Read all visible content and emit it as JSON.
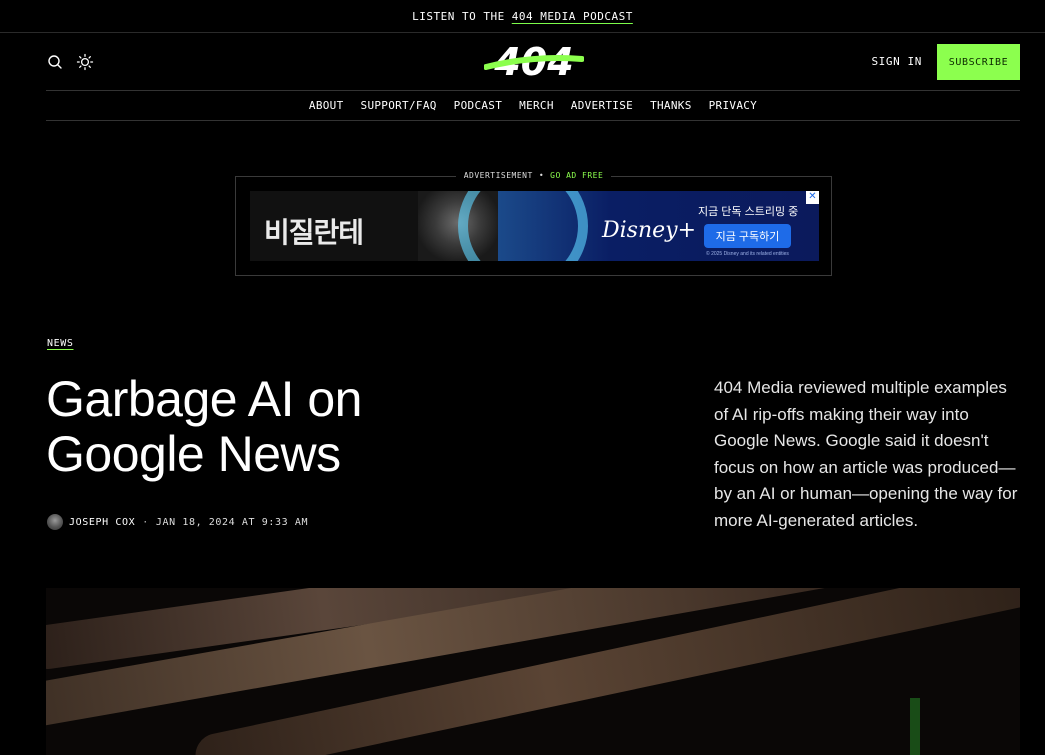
{
  "topbar": {
    "prefix": "LISTEN TO THE",
    "link": "404 MEDIA PODCAST"
  },
  "header": {
    "logo_text": "404",
    "search_icon": "search-icon",
    "theme_icon": "sun-icon",
    "signin_label": "SIGN IN",
    "subscribe_label": "SUBSCRIBE",
    "accent": "#8CFF4E"
  },
  "nav": {
    "items": [
      "ABOUT",
      "SUPPORT/FAQ",
      "PODCAST",
      "MERCH",
      "ADVERTISE",
      "THANKS",
      "PRIVACY"
    ]
  },
  "ad": {
    "label": "ADVERTISEMENT",
    "go_free": "GO AD FREE",
    "title": "비질란테",
    "brand": "Disney+",
    "headline_kr": "지금 단독 스트리밍 중",
    "cta_kr": "지금 구독하기",
    "copyright": "© 2025 Disney and its related entities",
    "close_icon": "close-icon"
  },
  "article": {
    "category": "NEWS",
    "title_line1": "Garbage AI on",
    "title_line2": "Google News",
    "author": "JOSEPH COX",
    "date": "JAN 18, 2024 AT 9:33 AM",
    "summary": "404 Media reviewed multiple examples of AI rip-offs making their way into Google News. Google said it doesn't focus on how an article was produced—by an AI or human—opening the way for more AI-generated articles."
  }
}
